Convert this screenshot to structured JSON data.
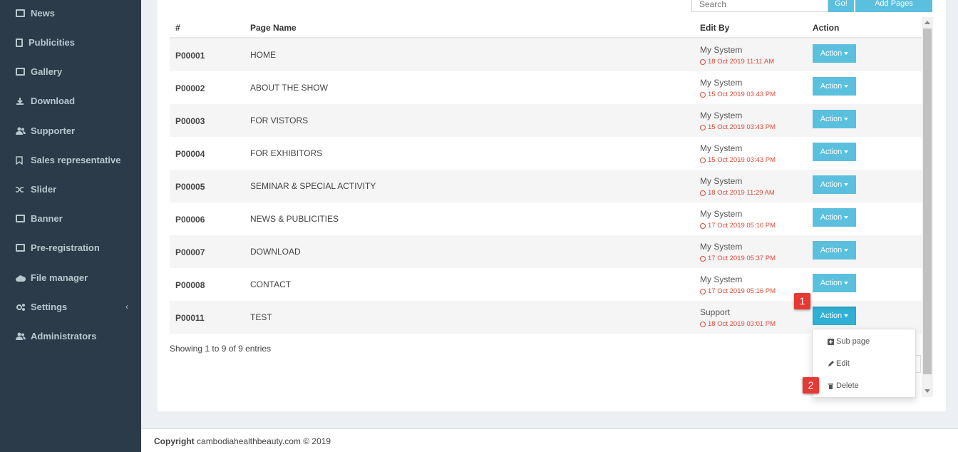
{
  "sidebar": {
    "items": [
      {
        "label": "News",
        "icon": "newspaper-icon"
      },
      {
        "label": "Publicities",
        "icon": "book-icon"
      },
      {
        "label": "Gallery",
        "icon": "image-icon"
      },
      {
        "label": "Download",
        "icon": "download-icon"
      },
      {
        "label": "Supporter",
        "icon": "users-icon"
      },
      {
        "label": "Sales representative",
        "icon": "bookmark-icon"
      },
      {
        "label": "Slider",
        "icon": "shuffle-icon"
      },
      {
        "label": "Banner",
        "icon": "picture-icon"
      },
      {
        "label": "Pre-registration",
        "icon": "list-icon"
      },
      {
        "label": "File manager",
        "icon": "cloud-icon"
      },
      {
        "label": "Settings",
        "icon": "gears-icon",
        "chevron": "‹"
      },
      {
        "label": "Administrators",
        "icon": "users-icon"
      }
    ]
  },
  "toolbar": {
    "search_placeholder": "Search",
    "go_label": "Go!",
    "add_label": "Add Pages"
  },
  "table": {
    "headers": {
      "id": "#",
      "name": "Page Name",
      "edit_by": "Edit By",
      "action": "Action"
    },
    "rows": [
      {
        "id": "P00001",
        "name": "HOME",
        "by": "My System",
        "date": "18 Oct 2019 11:11 AM",
        "action": "Action"
      },
      {
        "id": "P00002",
        "name": "ABOUT THE SHOW",
        "by": "My System",
        "date": "15 Oct 2019 03:43 PM",
        "action": "Action"
      },
      {
        "id": "P00003",
        "name": "FOR VISTORS",
        "by": "My System",
        "date": "15 Oct 2019 03:43 PM",
        "action": "Action"
      },
      {
        "id": "P00004",
        "name": "FOR EXHIBITORS",
        "by": "My System",
        "date": "15 Oct 2019 03:43 PM",
        "action": "Action"
      },
      {
        "id": "P00005",
        "name": "SEMINAR & SPECIAL ACTIVITY",
        "by": "My System",
        "date": "18 Oct 2019 11:29 AM",
        "action": "Action"
      },
      {
        "id": "P00006",
        "name": "NEWS & PUBLICITIES",
        "by": "My System",
        "date": "17 Oct 2019 05:16 PM",
        "action": "Action"
      },
      {
        "id": "P00007",
        "name": "DOWNLOAD",
        "by": "My System",
        "date": "17 Oct 2019 05:37 PM",
        "action": "Action"
      },
      {
        "id": "P00008",
        "name": "CONTACT",
        "by": "My System",
        "date": "17 Oct 2019 05:16 PM",
        "action": "Action"
      },
      {
        "id": "P00011",
        "name": "TEST",
        "by": "Support",
        "date": "18 Oct 2019 03:01 PM",
        "action": "Action"
      }
    ],
    "info": "Showing 1 to 9 of 9 entries"
  },
  "dropdown": {
    "items": [
      {
        "label": "Sub page",
        "icon": "plus-square-icon"
      },
      {
        "label": "Edit",
        "icon": "pencil-icon"
      },
      {
        "label": "Delete",
        "icon": "trash-icon"
      }
    ]
  },
  "badges": {
    "first": "1",
    "second": "2"
  },
  "footer": {
    "copyright_label": "Copyright",
    "copyright_text": "cambodiahealthbeauty.com © 2019"
  },
  "colors": {
    "sidebar_bg": "#2c3b49",
    "accent": "#5bc0de",
    "date_red": "#dd4b39",
    "badge_red": "#e53935"
  }
}
